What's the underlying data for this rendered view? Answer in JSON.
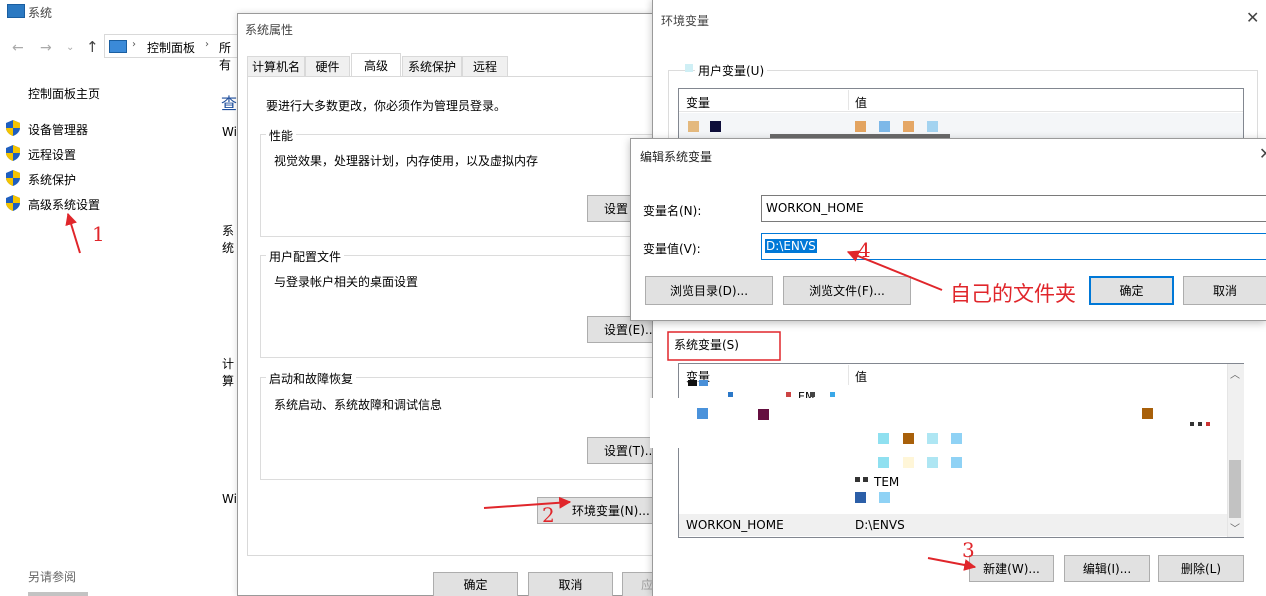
{
  "system_window": {
    "title": "系统",
    "breadcrumb": [
      "控制面板",
      "所有"
    ],
    "sidebar_home": "控制面板主页",
    "sidebar_items": [
      "设备管理器",
      "远程设置",
      "系统保护",
      "高级系统设置"
    ],
    "see_also": "另请参阅",
    "partial_labels": [
      "查",
      "Wi",
      "系统",
      "计算",
      "Wi"
    ]
  },
  "sys_props": {
    "title": "系统属性",
    "tabs": [
      "计算机名",
      "硬件",
      "高级",
      "系统保护",
      "远程"
    ],
    "admin_note": "要进行大多数更改，你必须作为管理员登录。",
    "perf_title": "性能",
    "perf_desc": "视觉效果，处理器计划，内存使用，以及虚拟内存",
    "perf_btn": "设置",
    "profile_title": "用户配置文件",
    "profile_desc": "与登录帐户相关的桌面设置",
    "profile_btn": "设置(E)...",
    "startup_title": "启动和故障恢复",
    "startup_desc": "系统启动、系统故障和调试信息",
    "startup_btn": "设置(T)...",
    "env_btn": "环境变量(N)...",
    "ok": "确定",
    "cancel": "取消",
    "apply": "应"
  },
  "env_window": {
    "title": "环境变量",
    "user_vars_label": "用户变量(U)",
    "col_var": "变量",
    "col_val": "值",
    "system_vars_label": "系统变量(S)",
    "sys_col_var": "变量",
    "sys_col_val": "值",
    "partial_var_text": "EM",
    "partial_val_text": "TEM",
    "selected_row": {
      "name": "WORKON_HOME",
      "value": "D:\\ENVS"
    },
    "new_btn": "新建(W)...",
    "edit_btn": "编辑(I)...",
    "delete_btn": "删除(L)"
  },
  "edit_dialog": {
    "title": "编辑系统变量",
    "name_label": "变量名(N):",
    "name_value": "WORKON_HOME",
    "value_label": "变量值(V):",
    "value_value": "D:\\ENVS",
    "browse_dir": "浏览目录(D)...",
    "browse_file": "浏览文件(F)...",
    "ok": "确定",
    "cancel": "取消"
  },
  "annotations": {
    "n1": "1",
    "n2": "2",
    "n3": "3",
    "n4": "4",
    "folder_note": "自己的文件夹"
  },
  "colors": {
    "annotation_red": "#e0262b",
    "selection_blue": "#0078d7",
    "button_gray": "#e1e1e1"
  }
}
